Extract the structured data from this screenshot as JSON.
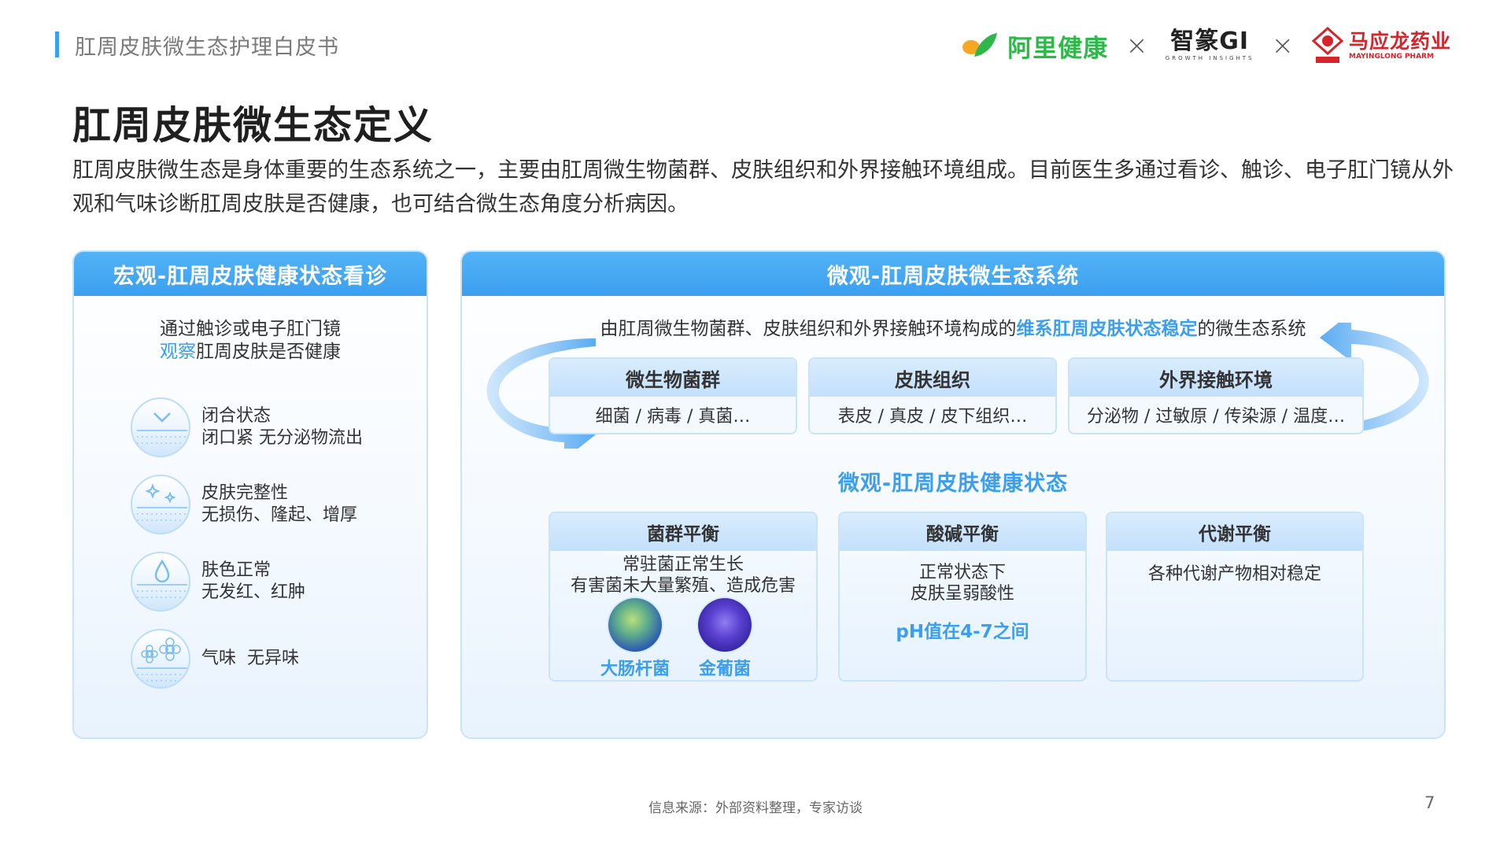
{
  "header": {
    "report_title": "肛周皮肤微生态护理白皮书",
    "logo_ali": "阿里健康",
    "separator": "×",
    "logo_zs": "智篆GI",
    "logo_zs_sub": "GROWTH INSIGHTS",
    "logo_myl_cn": "马应龙药业",
    "logo_myl_en": "MAYINGLONG PHARM",
    "colors": {
      "accent": "#3a9ff0",
      "ali_green": "#2eb84a",
      "myl_red": "#d8232a"
    }
  },
  "page_title": "肛周皮肤微生态定义",
  "intro": "肛周皮肤微生态是身体重要的生态系统之一，主要由肛周微生物菌群、皮肤组织和外界接触环境组成。目前医生多通过看诊、触诊、电子肛门镜从外观和气味诊断肛周皮肤是否健康，也可结合微生态角度分析病因。",
  "left_panel": {
    "title": "宏观-肛周皮肤健康状态看诊",
    "line1": "通过触诊或电子肛门镜",
    "line2_highlight": "观察",
    "line2_rest": "肛周皮肤是否健康",
    "items": [
      {
        "icon": "closed-state-icon",
        "title": "闭合状态",
        "desc": "闭口紧 无分泌物流出"
      },
      {
        "icon": "skin-integrity-icon",
        "title": "皮肤完整性",
        "desc": "无损伤、隆起、增厚"
      },
      {
        "icon": "skin-tone-icon",
        "title": "肤色正常",
        "desc": "无发红、红肿"
      },
      {
        "icon": "odor-icon",
        "title": "气味",
        "desc": "无异味"
      }
    ]
  },
  "right_panel": {
    "title": "微观-肛周皮肤微生态系统",
    "desc_pre": "由肛周微生物菌群、皮肤组织和外界接触环境构成的",
    "desc_highlight": "维系肛周皮肤状态稳定",
    "desc_post": "的微生态系统",
    "components": [
      {
        "title": "微生物菌群",
        "content": "细菌 / 病毒 / 真菌…"
      },
      {
        "title": "皮肤组织",
        "content": "表皮 / 真皮 / 皮下组织…"
      },
      {
        "title": "外界接触环境",
        "content": "分泌物 / 过敏原 / 传染源 / 温度…"
      }
    ],
    "health_title": "微观-肛周皮肤健康状态",
    "states": [
      {
        "title": "菌群平衡",
        "line1": "常驻菌正常生长",
        "line2": "有害菌未大量繁殖、造成危害",
        "bacteria": [
          {
            "name": "大肠杆菌",
            "icon": "e-coli-icon"
          },
          {
            "name": "金葡菌",
            "icon": "staphylococcus-icon"
          }
        ]
      },
      {
        "title": "酸碱平衡",
        "line1": "正常状态下",
        "line2": "皮肤呈弱酸性",
        "highlight": "pH值在4-7之间"
      },
      {
        "title": "代谢平衡",
        "line1": "各种代谢产物相对稳定"
      }
    ]
  },
  "footer": {
    "source": "信息来源：外部资料整理，专家访谈",
    "page_number": "7"
  }
}
